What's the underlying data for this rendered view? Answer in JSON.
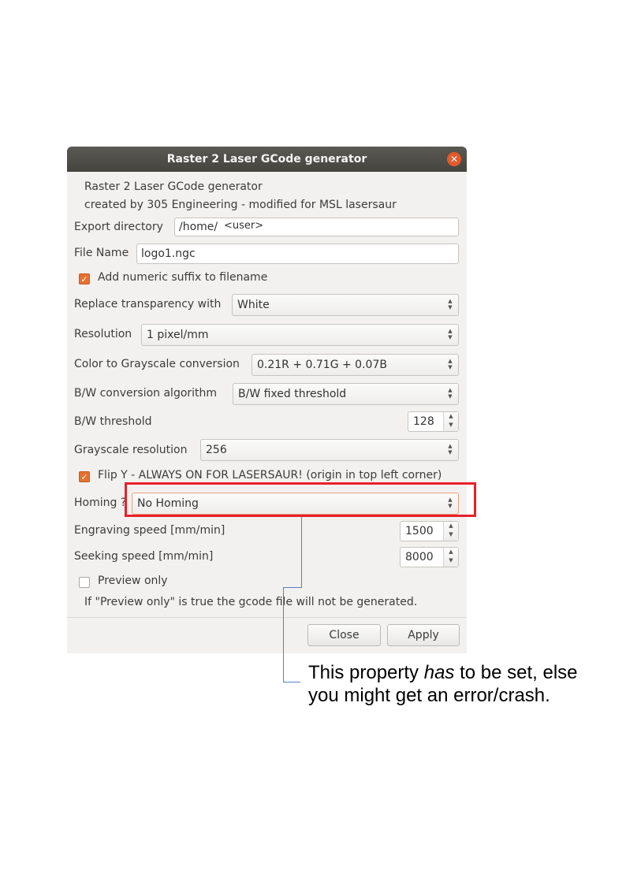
{
  "window": {
    "title": "Raster 2 Laser GCode generator",
    "close_icon": "close-icon"
  },
  "header": {
    "line1": "Raster 2 Laser GCode generator",
    "line2": "created by 305 Engineering - modified for MSL lasersaur"
  },
  "form": {
    "export_directory": {
      "label": "Export directory",
      "value": "/home/",
      "user_tag": "<user>"
    },
    "file_name": {
      "label": "File Name",
      "value": "logo1.ngc"
    },
    "numeric_suffix": {
      "label": "Add numeric suffix to filename",
      "checked": true
    },
    "transparency": {
      "label": "Replace transparency with",
      "value": "White"
    },
    "resolution": {
      "label": "Resolution",
      "value": "1 pixel/mm"
    },
    "grayscale_conversion": {
      "label": "Color to Grayscale conversion",
      "value": "0.21R + 0.71G + 0.07B"
    },
    "bw_algorithm": {
      "label": "B/W conversion algorithm",
      "value": "B/W fixed threshold"
    },
    "bw_threshold": {
      "label": "B/W threshold",
      "value": "128"
    },
    "grayscale_resolution": {
      "label": "Grayscale resolution",
      "value": "256"
    },
    "flip_y": {
      "label": "Flip Y - ALWAYS ON FOR LASERSAUR! (origin in top left corner)",
      "checked": true
    },
    "homing": {
      "label": "Homing ?",
      "value": "No Homing"
    },
    "engraving_speed": {
      "label": "Engraving speed [mm/min]",
      "value": "1500"
    },
    "seeking_speed": {
      "label": "Seeking speed [mm/min]",
      "value": "8000"
    },
    "preview_only": {
      "label": "Preview only",
      "checked": false
    },
    "preview_note": "If \"Preview only\" is true the gcode file will not be generated."
  },
  "buttons": {
    "close": "Close",
    "apply": "Apply"
  },
  "annotation": {
    "part1": "This property ",
    "emphasis": "has",
    "part2": " to be set, else",
    "line2": "you might get an error/crash.",
    "highlight_color": "#e8202a",
    "line_color": "#5b7fc2"
  },
  "colors": {
    "accent": "#e8702e",
    "titlebar": "#4d4c47"
  }
}
